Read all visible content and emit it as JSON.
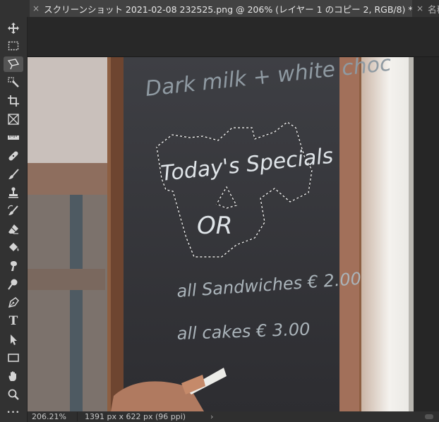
{
  "tabs": [
    {
      "title": "スクリーンショット 2021-02-08 232525.png @ 206% (レイヤー 1 のコピー 2, RGB/8) *",
      "active": true
    },
    {
      "title": "名称",
      "active": false
    }
  ],
  "close_glyph": "×",
  "toolbar": {
    "tools": [
      "move-icon",
      "marquee-icon",
      "polygonal-lasso-icon",
      "quick-selection-icon",
      "crop-icon",
      "frame-icon",
      "ruler-icon",
      "healing-brush-icon",
      "brush-icon",
      "stamp-icon",
      "history-brush-icon",
      "eraser-icon",
      "paint-bucket-icon",
      "smudge-icon",
      "dodge-icon",
      "pen-icon",
      "type-icon",
      "path-selection-icon",
      "rectangle-icon",
      "hand-icon",
      "zoom-icon",
      "more-icon"
    ],
    "type_glyph": "T",
    "more_glyph": "•••"
  },
  "chalkboard": {
    "line1": "Dark milk + white choc",
    "line2": "Today's Specials",
    "line3": "OR",
    "line4": "all Sandwiches € 2.00",
    "line5": "all cakes € 3.00"
  },
  "status": {
    "zoom": "206.21%",
    "dimensions": "1391 px x 622 px (96 ppi)",
    "arrow": "›"
  }
}
